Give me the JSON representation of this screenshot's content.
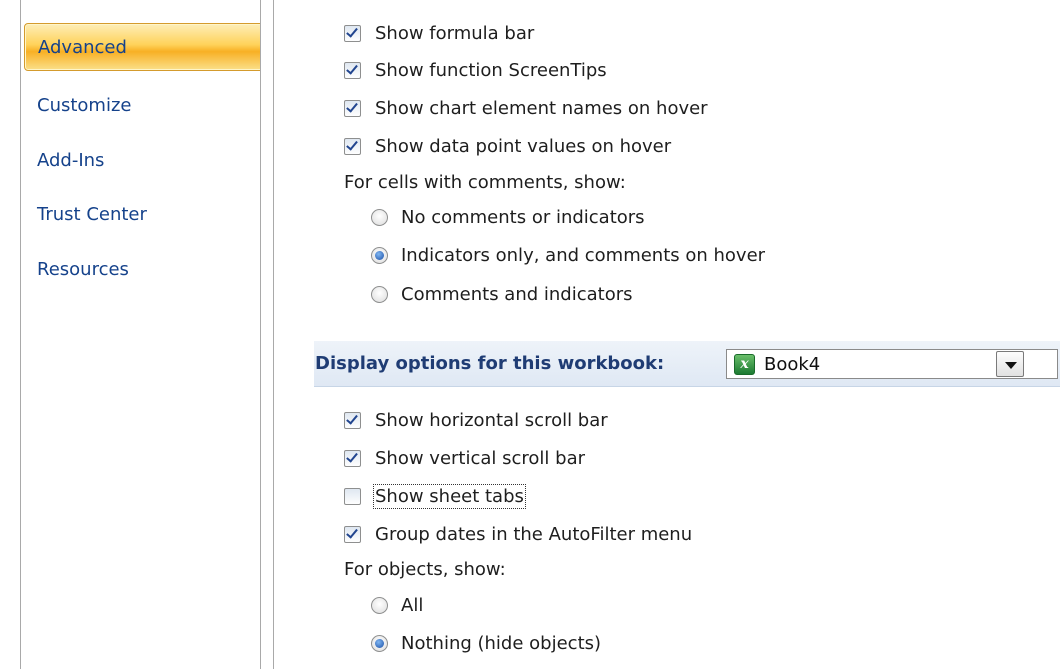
{
  "sidebar": {
    "items": [
      {
        "label": "Advanced"
      },
      {
        "label": "Customize"
      },
      {
        "label": "Add-Ins"
      },
      {
        "label": "Trust Center"
      },
      {
        "label": "Resources"
      }
    ]
  },
  "display": {
    "show_formula_bar": "Show formula bar",
    "show_function_screentips": "Show function ScreenTips",
    "show_chart_element_names": "Show chart element names on hover",
    "show_data_point_values": "Show data point values on hover",
    "comments_label": "For cells with comments, show:",
    "comments_options": [
      {
        "label": "No comments or indicators",
        "checked": false
      },
      {
        "label": "Indicators only, and comments on hover",
        "checked": true
      },
      {
        "label": "Comments and indicators",
        "checked": false
      }
    ]
  },
  "workbook": {
    "header": "Display options for this workbook:",
    "selected_workbook": "Book4",
    "options": [
      {
        "label": "Show horizontal scroll bar",
        "checked": true
      },
      {
        "label": "Show vertical scroll bar",
        "checked": true
      },
      {
        "label": "Show sheet tabs",
        "checked": false
      },
      {
        "label": "Group dates in the AutoFilter menu",
        "checked": true
      }
    ],
    "objects_label": "For objects, show:",
    "objects_options": [
      {
        "label": "All",
        "checked": false
      },
      {
        "label": "Nothing (hide objects)",
        "checked": true
      }
    ]
  },
  "icons": {
    "workbook": "excel-workbook-icon",
    "dropdown": "chevron-down-icon"
  }
}
